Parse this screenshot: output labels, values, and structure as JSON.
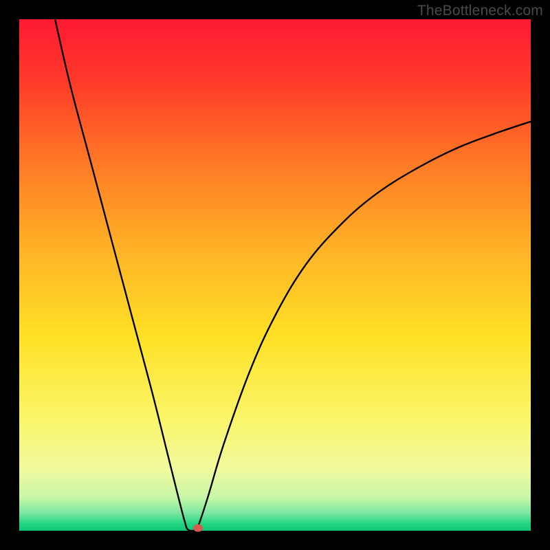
{
  "watermark": "TheBottleneck.com",
  "chart_data": {
    "type": "line",
    "title": "",
    "xlabel": "",
    "ylabel": "",
    "xlim": [
      0,
      100
    ],
    "ylim": [
      0,
      100
    ],
    "background_gradient": {
      "stops": [
        {
          "pos": 0.0,
          "color": "#ff1a33"
        },
        {
          "pos": 0.12,
          "color": "#ff3a2a"
        },
        {
          "pos": 0.28,
          "color": "#ff7a26"
        },
        {
          "pos": 0.45,
          "color": "#ffb326"
        },
        {
          "pos": 0.62,
          "color": "#ffe126"
        },
        {
          "pos": 0.78,
          "color": "#fbf66a"
        },
        {
          "pos": 0.88,
          "color": "#f1fa9e"
        },
        {
          "pos": 0.935,
          "color": "#c8f7a8"
        },
        {
          "pos": 0.965,
          "color": "#7de8a1"
        },
        {
          "pos": 0.985,
          "color": "#27d884"
        },
        {
          "pos": 1.0,
          "color": "#0cc478"
        }
      ]
    },
    "series": [
      {
        "name": "bottleneck-curve",
        "points": [
          {
            "x": 7.0,
            "y": 100.0
          },
          {
            "x": 10.0,
            "y": 87.0
          },
          {
            "x": 14.0,
            "y": 72.0
          },
          {
            "x": 18.0,
            "y": 57.0
          },
          {
            "x": 22.0,
            "y": 42.0
          },
          {
            "x": 26.0,
            "y": 27.0
          },
          {
            "x": 29.0,
            "y": 15.0
          },
          {
            "x": 31.0,
            "y": 7.0
          },
          {
            "x": 32.3,
            "y": 2.0
          },
          {
            "x": 33.0,
            "y": 0.2
          },
          {
            "x": 34.5,
            "y": 0.2
          },
          {
            "x": 35.2,
            "y": 1.5
          },
          {
            "x": 37.0,
            "y": 7.0
          },
          {
            "x": 40.0,
            "y": 17.0
          },
          {
            "x": 45.0,
            "y": 31.0
          },
          {
            "x": 50.0,
            "y": 42.0
          },
          {
            "x": 56.0,
            "y": 52.0
          },
          {
            "x": 63.0,
            "y": 60.0
          },
          {
            "x": 70.0,
            "y": 66.0
          },
          {
            "x": 78.0,
            "y": 71.0
          },
          {
            "x": 86.0,
            "y": 75.0
          },
          {
            "x": 94.0,
            "y": 78.0
          },
          {
            "x": 100.0,
            "y": 80.0
          }
        ]
      }
    ],
    "marker": {
      "x": 35.0,
      "y": 0.6,
      "color": "#d95a4e"
    }
  }
}
